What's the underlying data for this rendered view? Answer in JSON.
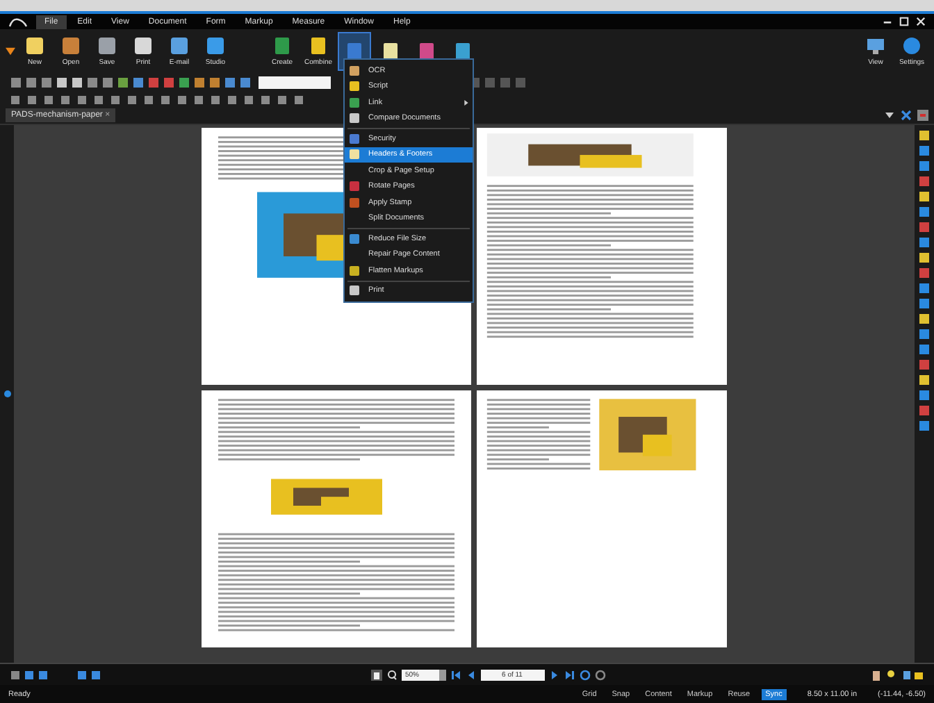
{
  "menu_bar": {
    "items": [
      {
        "label": "File",
        "selected": true
      },
      {
        "label": "Edit",
        "selected": false
      },
      {
        "label": "View",
        "selected": false
      },
      {
        "label": "Document",
        "selected": false
      },
      {
        "label": "Form",
        "selected": false
      },
      {
        "label": "Markup",
        "selected": false
      },
      {
        "label": "Measure",
        "selected": false
      },
      {
        "label": "Window",
        "selected": false
      },
      {
        "label": "Help",
        "selected": false
      }
    ]
  },
  "ribbon": {
    "left": [
      {
        "label": "New"
      },
      {
        "label": "Open"
      },
      {
        "label": "Save"
      },
      {
        "label": "Print"
      },
      {
        "label": "E-mail"
      },
      {
        "label": "Studio"
      }
    ],
    "middle": [
      {
        "label": "Create",
        "selected": false
      },
      {
        "label": "Combine",
        "selected": false
      },
      {
        "selected": true
      },
      {
        "selected": false
      },
      {
        "selected": false
      },
      {
        "selected": false
      }
    ],
    "right": [
      {
        "label": "View"
      },
      {
        "label": "Settings"
      }
    ]
  },
  "tab": {
    "label": "PADS-mechanism-paper",
    "close": "×"
  },
  "dropdown": {
    "groups": [
      [
        {
          "label": "OCR",
          "submenu": false,
          "selected": false
        },
        {
          "label": "Script",
          "submenu": false,
          "selected": false
        },
        {
          "label": "Link",
          "submenu": true,
          "selected": false
        },
        {
          "label": "Compare Documents",
          "submenu": false,
          "selected": false
        }
      ],
      [
        {
          "label": "Security",
          "submenu": false,
          "selected": false
        },
        {
          "label": "Headers & Footers",
          "submenu": false,
          "selected": true
        },
        {
          "label": "Crop & Page Setup",
          "submenu": false,
          "selected": false
        },
        {
          "label": "Rotate Pages",
          "submenu": false,
          "selected": false
        },
        {
          "label": "Apply Stamp",
          "submenu": false,
          "selected": false
        },
        {
          "label": "Split Documents",
          "submenu": false,
          "selected": false
        }
      ],
      [
        {
          "label": "Reduce File Size",
          "submenu": false,
          "selected": false
        },
        {
          "label": "Repair Page Content",
          "submenu": false,
          "selected": false
        },
        {
          "label": "Flatten Markups",
          "submenu": false,
          "selected": false
        }
      ],
      [
        {
          "label": "Print",
          "submenu": false,
          "selected": false
        }
      ]
    ]
  },
  "bottom_toolbar": {
    "zoom": "50%",
    "page": "6 of 11"
  },
  "status_bar": {
    "message": "Ready",
    "toggles": [
      {
        "label": "Grid",
        "selected": false
      },
      {
        "label": "Snap",
        "selected": false
      },
      {
        "label": "Content",
        "selected": false
      },
      {
        "label": "Markup",
        "selected": false
      },
      {
        "label": "Reuse",
        "selected": false
      },
      {
        "label": "Sync",
        "selected": true
      }
    ],
    "page_size": "8.50 x 11.00 in",
    "coordinates": "(-11.44, -6.50)"
  }
}
